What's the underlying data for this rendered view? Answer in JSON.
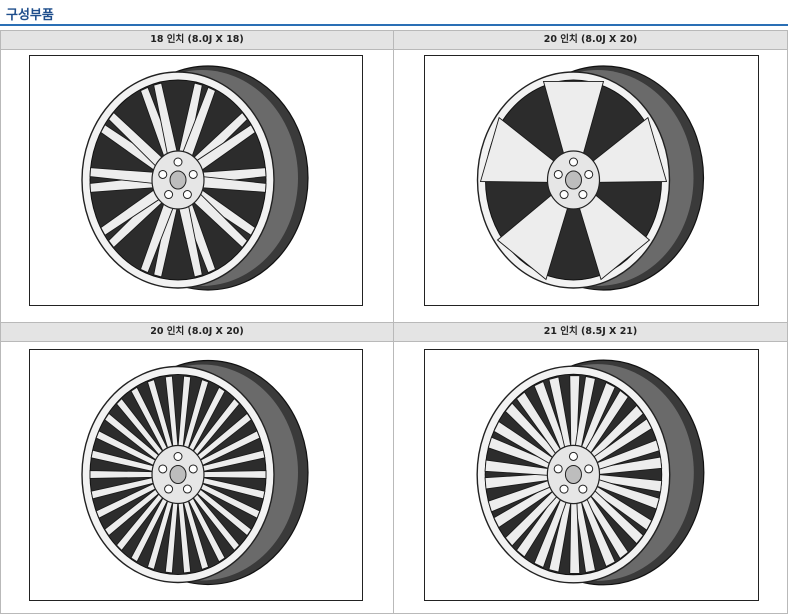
{
  "page": {
    "title": "구성부품"
  },
  "cells": [
    {
      "label": "18 인치 (8.0J X 18)",
      "icon": "wheel-18in-twin-spoke"
    },
    {
      "label": "20 인치 (8.0J X 20)",
      "icon": "wheel-20in-five-spoke"
    },
    {
      "label": "20 인치 (8.0J X 20)",
      "icon": "wheel-20in-multi-spoke"
    },
    {
      "label": "21 인치 (8.5J X 21)",
      "icon": "wheel-21in-lattice-spoke"
    }
  ]
}
